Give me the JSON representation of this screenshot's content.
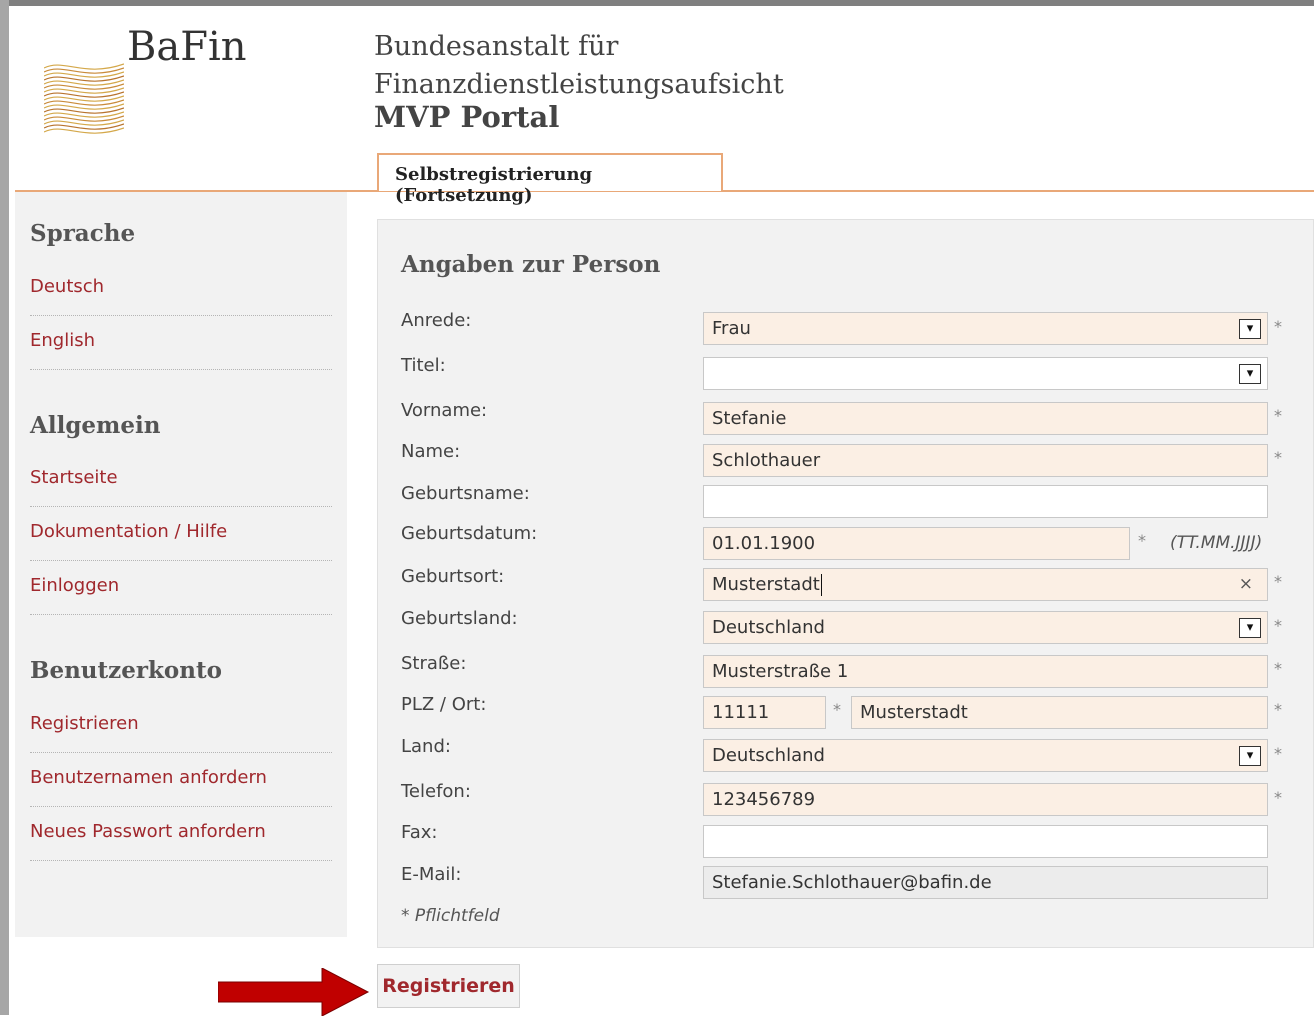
{
  "header": {
    "logo_text": "BaFin",
    "agency_line1": "Bundesanstalt für",
    "agency_line2": "Finanzdienstleistungsaufsicht",
    "portal": "MVP Portal",
    "tab_label": "Selbstregistrierung (Fortsetzung)"
  },
  "sidebar": {
    "sections": [
      {
        "heading": "Sprache",
        "links": [
          "Deutsch",
          "English"
        ]
      },
      {
        "heading": "Allgemein",
        "links": [
          "Startseite",
          "Dokumentation / Hilfe",
          "Einloggen"
        ]
      },
      {
        "heading": "Benutzerkonto",
        "links": [
          "Registrieren",
          "Benutzernamen anfordern",
          "Neues Passwort anfordern"
        ]
      }
    ]
  },
  "form": {
    "title": "Angaben zur Person",
    "required_marker": "*",
    "fields": {
      "anrede": {
        "label": "Anrede:",
        "value": "Frau"
      },
      "titel": {
        "label": "Titel:",
        "value": ""
      },
      "vorname": {
        "label": "Vorname:",
        "value": "Stefanie"
      },
      "name": {
        "label": "Name:",
        "value": "Schlothauer"
      },
      "geburtsname": {
        "label": "Geburtsname:",
        "value": ""
      },
      "geburtsdatum": {
        "label": "Geburtsdatum:",
        "value": "01.01.1900",
        "hint": "(TT.MM.JJJJ)"
      },
      "geburtsort": {
        "label": "Geburtsort:",
        "value": "Musterstadt"
      },
      "geburtsland": {
        "label": "Geburtsland:",
        "value": "Deutschland"
      },
      "strasse": {
        "label": "Straße:",
        "value": "Musterstraße 1"
      },
      "plz_ort": {
        "label": "PLZ / Ort:",
        "plz": "11111",
        "ort": "Musterstadt"
      },
      "land": {
        "label": "Land:",
        "value": "Deutschland"
      },
      "telefon": {
        "label": "Telefon:",
        "value": "123456789"
      },
      "fax": {
        "label": "Fax:",
        "value": ""
      },
      "email": {
        "label": "E-Mail:",
        "value": "Stefanie.Schlothauer@bafin.de"
      }
    },
    "required_note": "* Pflichtfeld",
    "submit_label": "Registrieren"
  },
  "icons": {
    "dropdown": "▾",
    "clear": "×"
  },
  "colors": {
    "accent": "#e9a878",
    "link": "#a0282d",
    "required_bg": "#fbefe4",
    "arrow": "#c00000"
  }
}
